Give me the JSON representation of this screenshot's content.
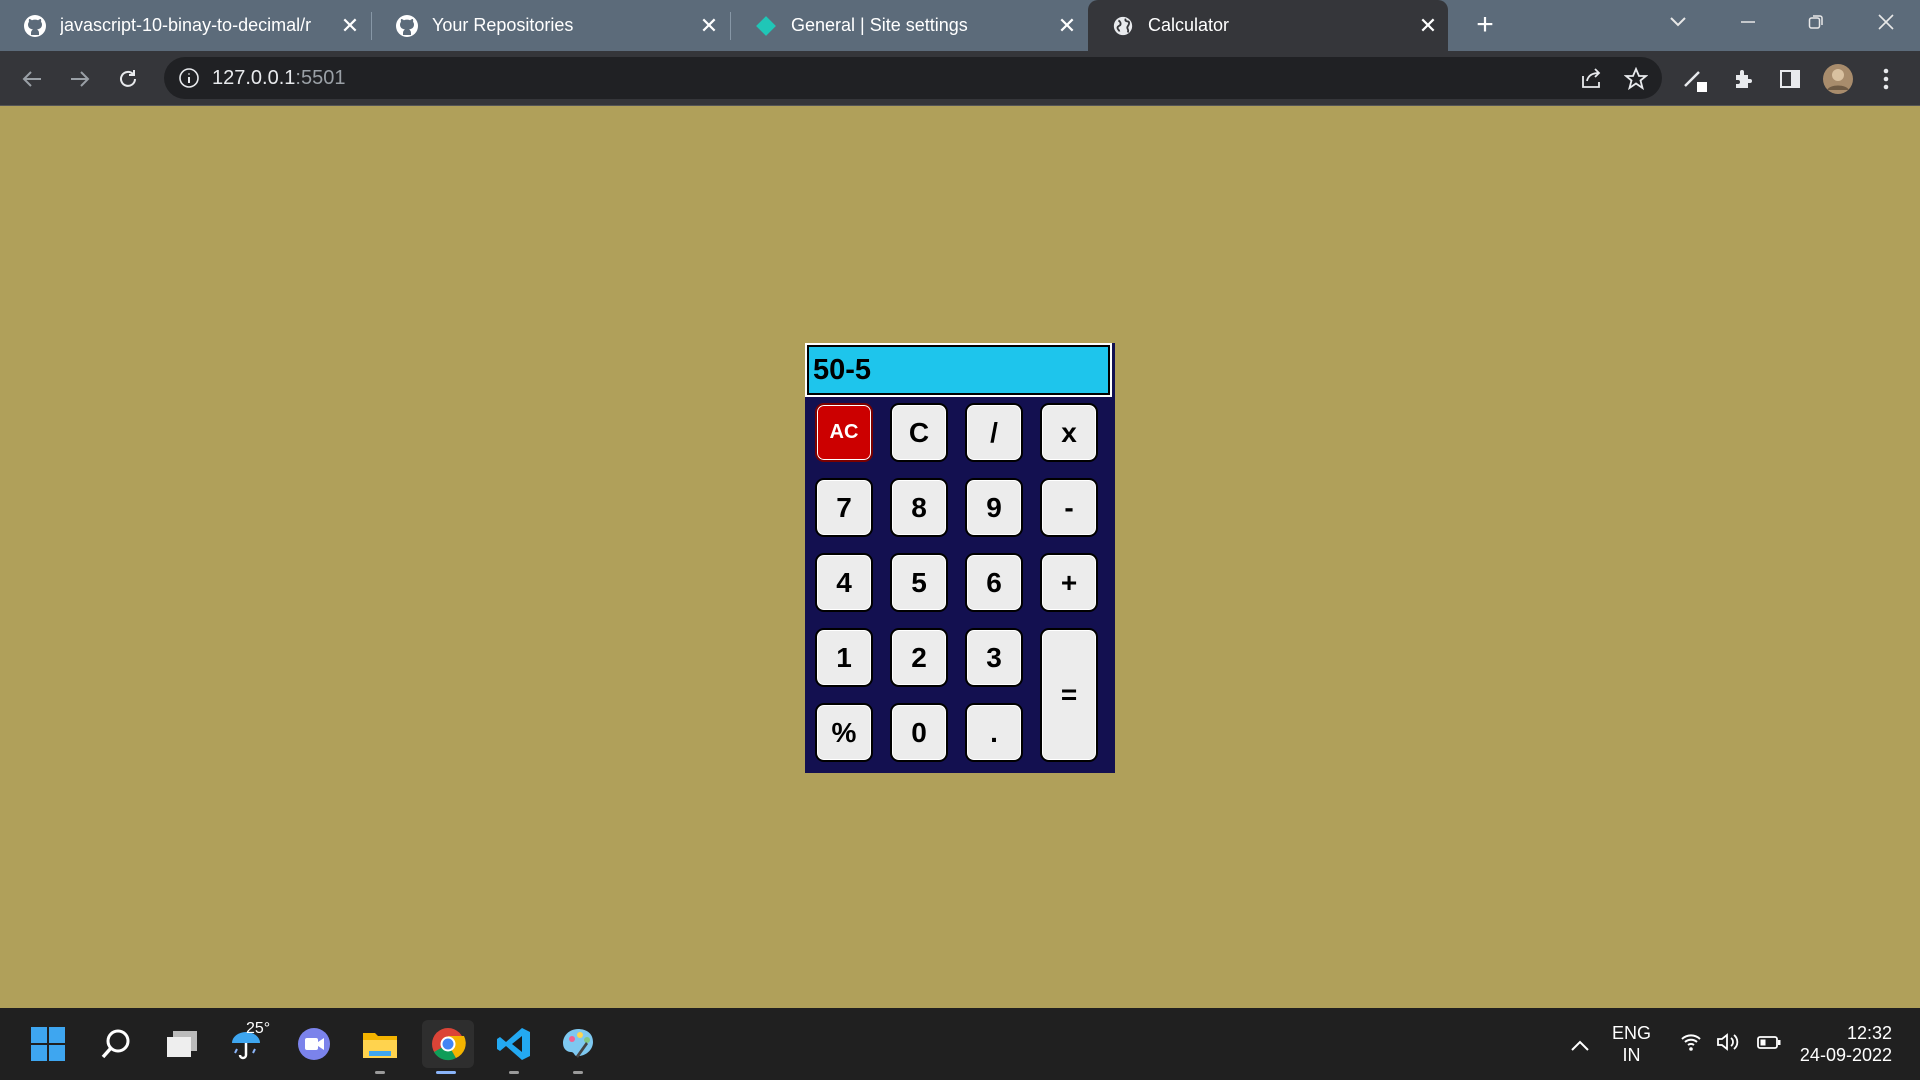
{
  "browser": {
    "tabs": [
      {
        "title": "javascript-10-binay-to-decimal/r",
        "icon": "github-icon",
        "active": false
      },
      {
        "title": "Your Repositories",
        "icon": "github-icon",
        "active": false
      },
      {
        "title": "General | Site settings",
        "icon": "netlify-icon",
        "active": false
      },
      {
        "title": "Calculator",
        "icon": "globe-icon",
        "active": true
      }
    ],
    "close_glyph": "✕",
    "new_tab_glyph": "+",
    "url_host": "127.0.0.1",
    "url_port": ":5501"
  },
  "calculator": {
    "display_value": "50-5",
    "keys": {
      "ac": "AC",
      "c": "C",
      "divide": "/",
      "multiply": "x",
      "k7": "7",
      "k8": "8",
      "k9": "9",
      "minus": "-",
      "k4": "4",
      "k5": "5",
      "k6": "6",
      "plus": "+",
      "k1": "1",
      "k2": "2",
      "k3": "3",
      "equals": "=",
      "percent": "%",
      "k0": "0",
      "dot": "."
    },
    "colors": {
      "display": "#1ec5ec",
      "body": "#131050",
      "ac": "#cc0000",
      "page": "#b0a05a"
    }
  },
  "taskbar": {
    "temperature": "25°",
    "lang_line1": "ENG",
    "lang_line2": "IN",
    "time": "12:32",
    "date": "24-09-2022"
  }
}
